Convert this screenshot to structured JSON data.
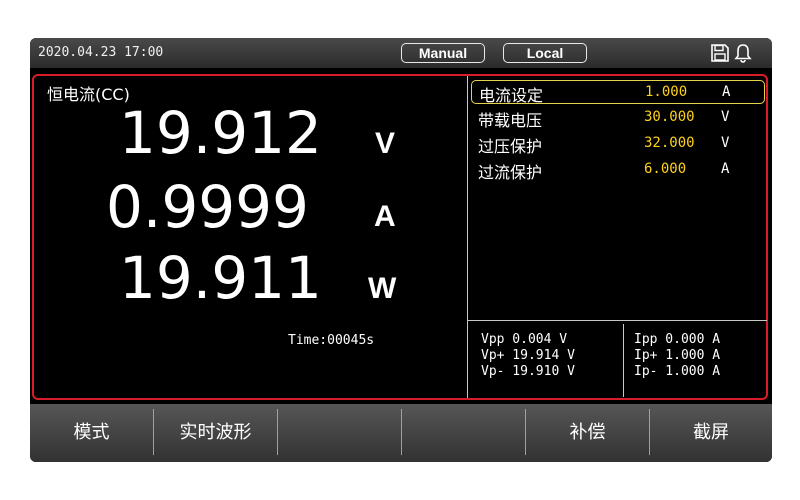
{
  "status_bar": {
    "datetime": "2020.04.23 17:00",
    "mode_badge": "Manual",
    "control_badge": "Local",
    "icons": [
      "save-icon",
      "bell-icon"
    ]
  },
  "readout": {
    "mode_title": "恒电流(CC)",
    "voltage": {
      "value": "19.912",
      "unit": "V"
    },
    "current": {
      "value": "0.9999",
      "unit": "A"
    },
    "power": {
      "value": "19.911",
      "unit": "W"
    },
    "elapsed": "Time:00045s"
  },
  "settings": [
    {
      "name": "电流设定",
      "value": "1.000",
      "unit": "A",
      "selected": true
    },
    {
      "name": "带载电压",
      "value": "30.000",
      "unit": "V",
      "selected": false
    },
    {
      "name": "过压保护",
      "value": "32.000",
      "unit": "V",
      "selected": false
    },
    {
      "name": "过流保护",
      "value": "6.000",
      "unit": "A",
      "selected": false
    }
  ],
  "stats": {
    "voltage": [
      "Vpp 0.004 V",
      "Vp+ 19.914 V",
      "Vp- 19.910 V"
    ],
    "current": [
      "Ipp 0.000 A",
      "Ip+ 1.000 A",
      "Ip- 1.000 A"
    ]
  },
  "softkeys": [
    "模式",
    "实时波形",
    "",
    "",
    "补偿",
    "截屏"
  ],
  "colors": {
    "border_red": "#d81c2a",
    "selection_yellow": "#e6d24a",
    "value_yellow": "#ffd21a",
    "screen_bg": "#000000"
  }
}
